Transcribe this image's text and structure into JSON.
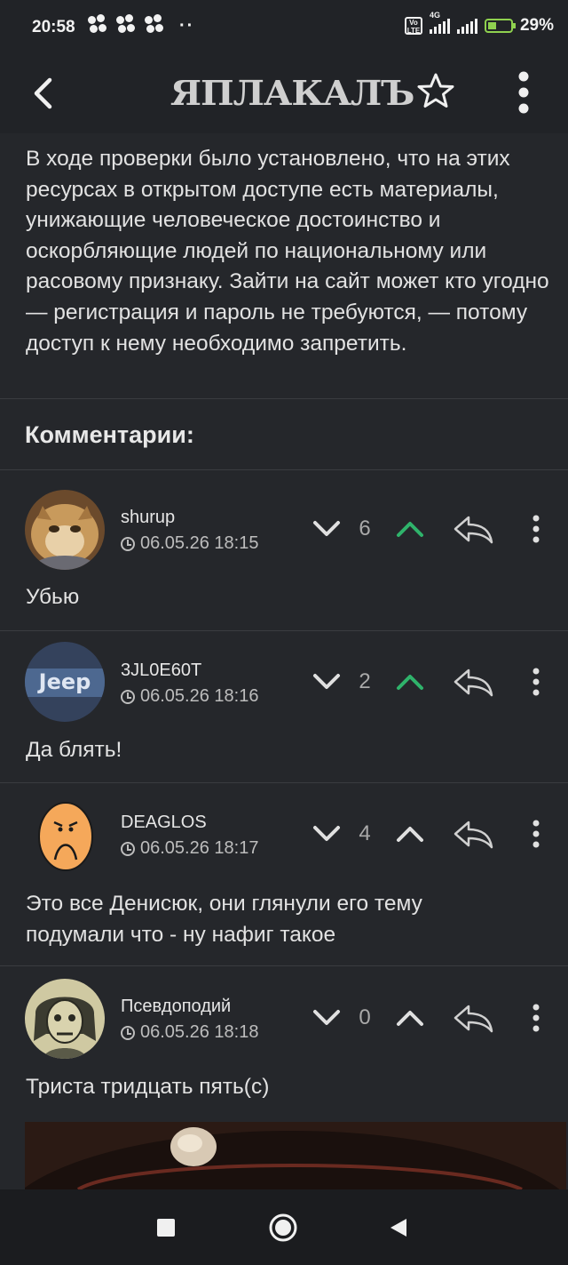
{
  "status_bar": {
    "time": "20:58",
    "more_indicator": "··",
    "network": "4G",
    "battery_percent": "29%"
  },
  "app_bar": {
    "logo_text": "ЯПЛАКАЛЪ",
    "back_icon": "chevron-left-icon",
    "star_icon": "star-outline-icon",
    "menu_icon": "vertical-dots-icon"
  },
  "article": {
    "text": "В ходе проверки было установлено, что на этих ресурсах в открытом доступе есть материалы, унижающие человеческое достоинство и оскорбляющие людей по национальному или расовому признаку. Зайти на сайт может кто угодно — регистрация и пароль не требуются, — потому доступ к нему необходимо запретить."
  },
  "comments_header": "Комментарии:",
  "comments": [
    {
      "username": "shurup",
      "date": "06.05.26 18:15",
      "score": "6",
      "up_active": true,
      "text": "Убью"
    },
    {
      "username": "3JL0E60T",
      "date": "06.05.26 18:16",
      "score": "2",
      "up_active": true,
      "text": "Да блять!"
    },
    {
      "username": "DEAGLOS",
      "date": "06.05.26 18:17",
      "score": "4",
      "up_active": false,
      "text": "Это все Денисюк, они глянули его тему подумали что - ну нафиг такое"
    },
    {
      "username": "Псевдоподий",
      "date": "06.05.26 18:18",
      "score": "0",
      "up_active": false,
      "text": "Триста тридцать пять(с)"
    }
  ],
  "colors": {
    "background": "#25272b",
    "upvote_active": "#2fb36b",
    "icon": "#cfcfcf"
  }
}
